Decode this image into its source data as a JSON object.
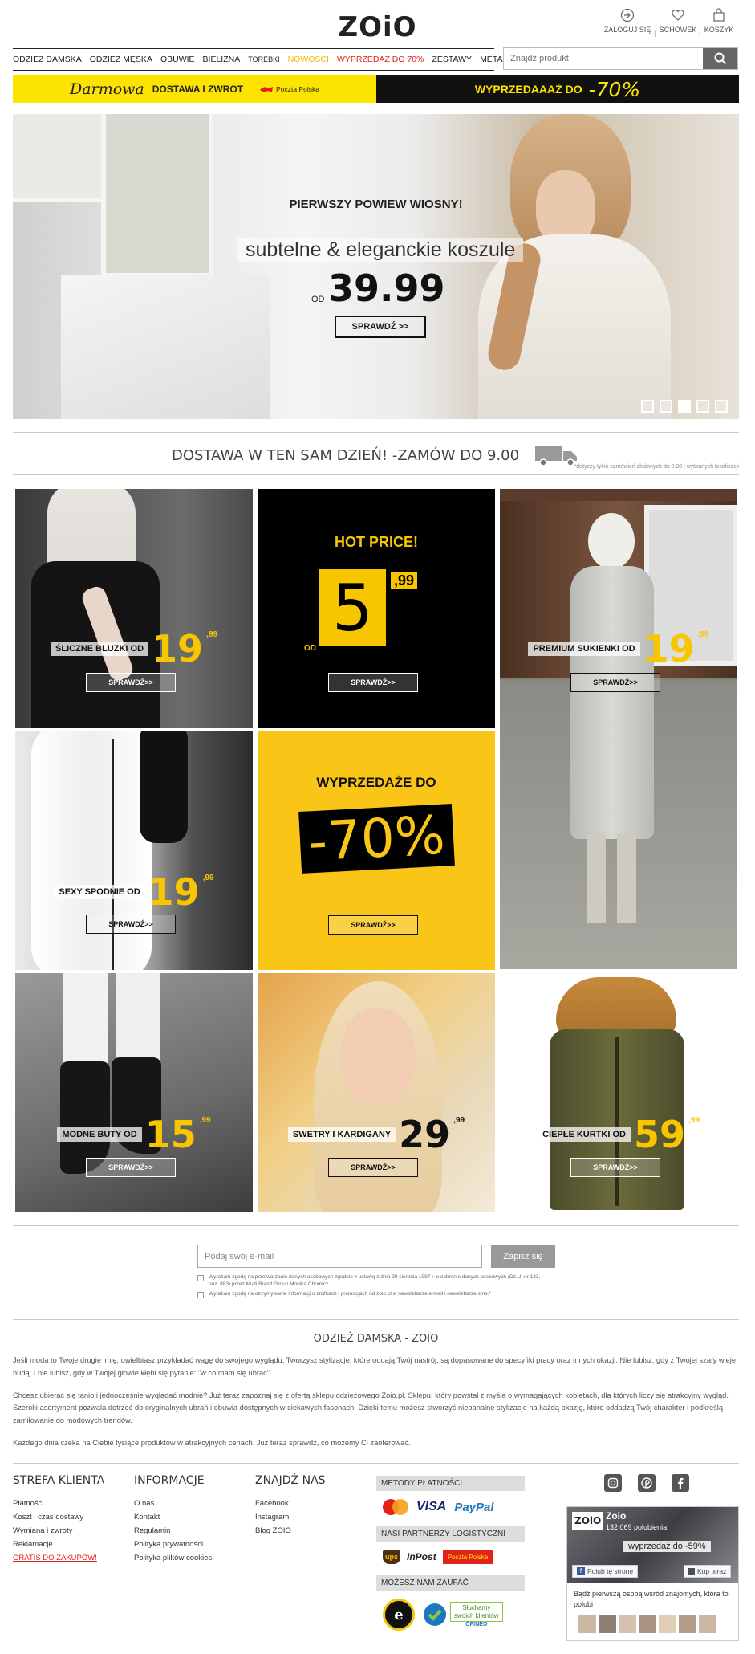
{
  "header": {
    "logo": "ZOiO",
    "account": {
      "login": "ZALOGUJ SIĘ",
      "saved": "SCHOWEK",
      "cart": "KOSZYK"
    },
    "nav": [
      {
        "label": "ODZIEŻ DAMSKA",
        "style": "normal"
      },
      {
        "label": "ODZIEŻ MĘSKA",
        "style": "normal"
      },
      {
        "label": "OBUWIE",
        "style": "normal"
      },
      {
        "label": "BIELIZNA",
        "style": "normal"
      },
      {
        "label": "TOREBKI",
        "style": "small"
      },
      {
        "label": "NOWOŚCI",
        "style": "yellow"
      },
      {
        "label": "WYPRZEDAŻ DO 70%",
        "style": "red"
      },
      {
        "label": "ZESTAWY",
        "style": "normal"
      },
      {
        "label": "METAMORFOZY",
        "style": "normal"
      }
    ],
    "search": {
      "placeholder": "Znajdź produkt"
    }
  },
  "banners": {
    "left_script": "Darmowa",
    "left_bold": "DOSTAWA I ZWROT",
    "left_partner": "Poczta Polska",
    "right_text": "WYPRZEDAAAŻ DO",
    "right_percent": "-70%"
  },
  "hero": {
    "tagline": "PIERWSZY POWIEW WIOSNY!",
    "subtitle": "subtelne & eleganckie koszule",
    "from": "OD",
    "price": "39.99",
    "button": "SPRAWDŹ >>",
    "slides": 5,
    "active_slide": 3
  },
  "delivery": {
    "text": "DOSTAWA W TEN SAM DZIEŃ! -ZAMÓW DO 9.00",
    "note": "*dotyczy tylko zamówień złożonych do 9.00 i wybranych lokalizacji"
  },
  "tiles": {
    "blouses": {
      "label": "ŚLICZNE BLUZKI OD",
      "price": "19",
      "cents": ",99",
      "button": "SPRAWDŹ>>"
    },
    "hot": {
      "title": "HOT PRICE!",
      "from": "OD",
      "price": "5",
      "cents": ",99",
      "button": "SPRAWDŹ>>"
    },
    "dresses": {
      "label": "PREMIUM SUKIENKI OD",
      "price": "19",
      "cents": ",99",
      "button": "SPRAWDŹ>>"
    },
    "pants": {
      "label": "SEXY SPODNIE OD",
      "price": "19",
      "cents": ",99",
      "button": "SPRAWDŹ>>"
    },
    "sale": {
      "title": "WYPRZEDAŻE DO",
      "value": "-70%",
      "button": "SPRAWDŹ>>"
    },
    "shoes": {
      "label": "MODNE BUTY OD",
      "price": "15",
      "cents": ",99",
      "button": "SPRAWDŹ>>"
    },
    "sweaters": {
      "label": "SWETRY I KARDIGANY",
      "price": "29",
      "cents": ",99",
      "button": "SPRAWDŹ>>"
    },
    "jackets": {
      "label": "CIEPŁE KURTKI OD",
      "price": "59",
      "cents": ",99",
      "button": "SPRAWDŹ>>"
    }
  },
  "newsletter": {
    "placeholder": "Podaj swój e-mail",
    "button": "Zapisz się",
    "consent1": "Wyrażam zgodę na przetwarzanie danych osobowych zgodnie z ustawą z dnia 29 sierpnia 1997 r. o ochronie danych osobowych (Dz.U. nr 133, poz. 883) przez Multi Brand Group Monika Chomicz",
    "consent2": "Wyrażam zgodę na otrzymywanie informacji o zniżkach i promocjach od zoio.pl w newsletterze e-mail i newsletterze sms.*"
  },
  "seo": {
    "title": "ODZIEŻ DAMSKA - ZOIO",
    "p1": "Jeśli moda to Twoje drugie imię, uwielbiasz przykładać wagę do swojego wyglądu. Tworzysz stylizacje, które oddają Twój nastrój, są dopasowane do specyfiki pracy oraz innych okazji. Nie lubisz, gdy z Twojej szafy wieje nudą. I nie lubisz, gdy w Twojej głowie kłębi się pytanie: \"w co mam się ubrać\".",
    "p2": "Chcesz ubierać się tanio i jednocześnie wyglądać modnie? Już teraz zapoznaj się z ofertą sklepu odzieżowego Zoio.pl. Sklepu, który powstał z myślą o wymagających kobietach, dla których liczy się atrakcyjny wygląd. Szeroki asortyment pozwala dotrzeć do oryginalnych ubrań i obuwia dostępnych w ciekawych fasonach. Dzięki temu możesz stworzyć niebanalne stylizacje na każdą okazję, które oddadzą Twój charakter i podkreślą zamiłowanie do modowych trendów.",
    "p3": "Każdego dnia czeka na Ciebie tysiące produktów w atrakcyjnych cenach. Już teraz sprawdź, co możemy Ci zaoferować."
  },
  "footer": {
    "client": {
      "title": "STREFA KLIENTA",
      "links": [
        "Płatności",
        "Koszt i czas dostawy",
        "Wymiana i zwroty",
        "Reklamacje"
      ],
      "promo": "GRATIS DO ZAKUPÓW!"
    },
    "info": {
      "title": "INFORMACJE",
      "links": [
        "O nas",
        "Kontakt",
        "Regulamin",
        "Polityka prywatności",
        "Polityka plików cookies"
      ]
    },
    "find": {
      "title": "ZNAJDŹ NAS",
      "links": [
        "Facebook",
        "Instagram",
        "Blog ZOIO"
      ]
    },
    "payments": {
      "title": "METODY PŁATNOŚCI",
      "visa": "VISA",
      "paypal": "PayPal",
      "mastercard": "MasterCard"
    },
    "logistics": {
      "title": "NASI PARTNERZY LOGISTYCZNI",
      "ups": "ups",
      "inpost": "InPost",
      "poczta": "Poczta Polska"
    },
    "trust": {
      "title": "MOŻESZ NAM ZAUFAĆ",
      "opineo_top": "Słuchamy",
      "opineo_bottom": "swoich klientów",
      "opineo_name": "OPINEO"
    },
    "facebook": {
      "page": "Zoio",
      "likes": "132 069 polubienia",
      "sale": "wyprzedaż do -59%",
      "like_btn": "Polub tę stronę",
      "buy_btn": "Kup teraz",
      "invite": "Bądź pierwszą osobą wśród znajomych, która to polubi"
    }
  }
}
